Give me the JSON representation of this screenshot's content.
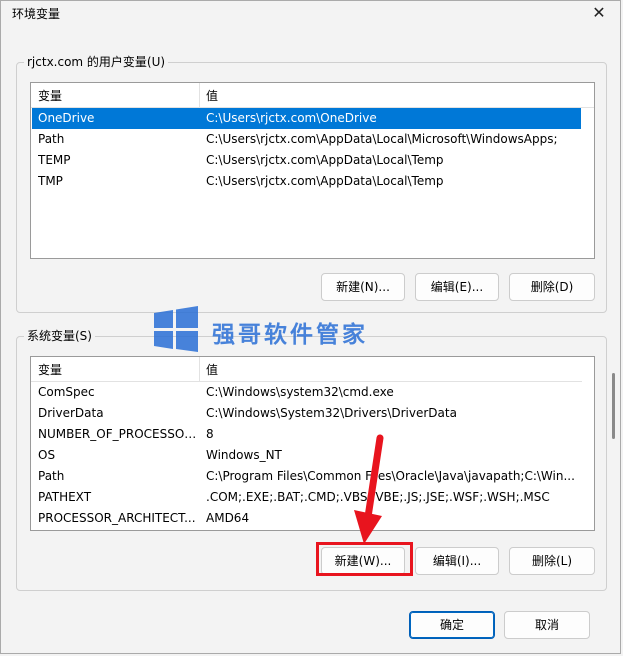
{
  "window": {
    "title": "环境变量",
    "close_icon": "close-icon"
  },
  "user_vars": {
    "group_label": "rjctx.com 的用户变量(U)",
    "col_var": "变量",
    "col_val": "值",
    "rows": [
      {
        "name": "OneDrive",
        "value": "C:\\Users\\rjctx.com\\OneDrive",
        "selected": true
      },
      {
        "name": "Path",
        "value": "C:\\Users\\rjctx.com\\AppData\\Local\\Microsoft\\WindowsApps;"
      },
      {
        "name": "TEMP",
        "value": "C:\\Users\\rjctx.com\\AppData\\Local\\Temp"
      },
      {
        "name": "TMP",
        "value": "C:\\Users\\rjctx.com\\AppData\\Local\\Temp"
      }
    ],
    "btn_new": "新建(N)...",
    "btn_edit": "编辑(E)...",
    "btn_delete": "删除(D)"
  },
  "system_vars": {
    "group_label": "系统变量(S)",
    "col_var": "变量",
    "col_val": "值",
    "rows": [
      {
        "name": "ComSpec",
        "value": "C:\\Windows\\system32\\cmd.exe"
      },
      {
        "name": "DriverData",
        "value": "C:\\Windows\\System32\\Drivers\\DriverData"
      },
      {
        "name": "NUMBER_OF_PROCESSORS",
        "value": "8"
      },
      {
        "name": "OS",
        "value": "Windows_NT"
      },
      {
        "name": "Path",
        "value": "C:\\Program Files\\Common Files\\Oracle\\Java\\javapath;C:\\Win..."
      },
      {
        "name": "PATHEXT",
        "value": ".COM;.EXE;.BAT;.CMD;.VBS;.VBE;.JS;.JSE;.WSF;.WSH;.MSC"
      },
      {
        "name": "PROCESSOR_ARCHITECT...",
        "value": "AMD64"
      }
    ],
    "btn_new": "新建(W)...",
    "btn_edit": "编辑(I)...",
    "btn_delete": "删除(L)"
  },
  "footer": {
    "ok": "确定",
    "cancel": "取消"
  },
  "watermark": {
    "text": "强哥软件管家"
  },
  "colors": {
    "selection": "#0078d7",
    "highlight": "#e8141e",
    "watermark": "#2a6fd6"
  }
}
